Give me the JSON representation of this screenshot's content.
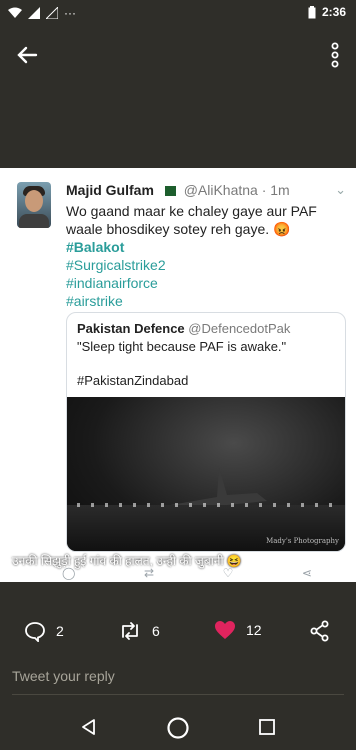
{
  "status": {
    "time": "2:36",
    "battery_icon": "battery-icon",
    "signal_icon": "signal-icon",
    "wifi_icon": "wifi-icon"
  },
  "tweet": {
    "name": "Majid Gulfam",
    "handle": "@AliKhatna · 1m",
    "text": "Wo gaand maar ke chaley gaye aur PAF waale bhosdikey sotey reh gaye. 😡",
    "hashtags": [
      "#Balakot",
      "#Surgicalstrike2",
      "#indianairforce",
      "#airstrike"
    ],
    "quote": {
      "name": "Pakistan Defence",
      "handle": "@DefencedotPak",
      "line1": "\"Sleep tight because PAF is awake.\"",
      "line2": "#PakistanZindabad",
      "watermark": "Mady's Photography"
    },
    "overlay": "उनकी सिझुड़ी हुई गांव की हालत, उन्ही की जुबानी 😆"
  },
  "actions": {
    "replies": "2",
    "retweets": "6",
    "likes": "12"
  },
  "reply_input": {
    "placeholder": "Tweet your reply"
  },
  "colors": {
    "accent": "#2a9d9a",
    "like": "#e0245e",
    "background": "#2f2e29"
  }
}
